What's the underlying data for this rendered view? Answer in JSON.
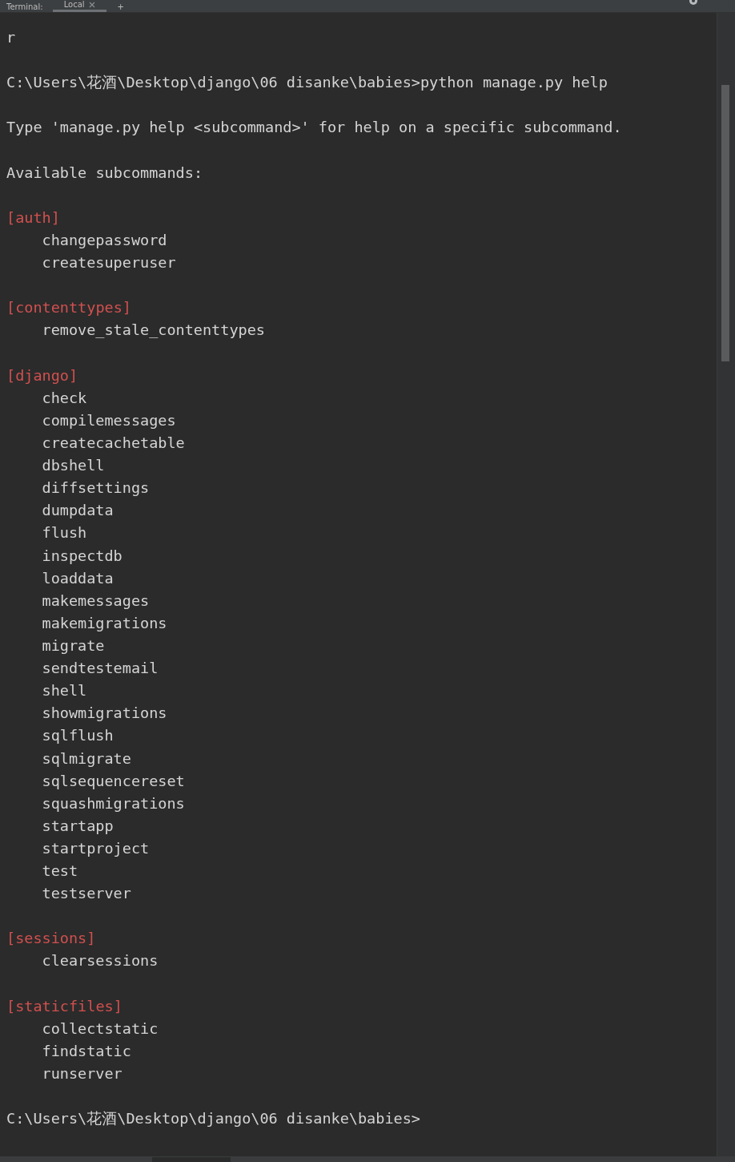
{
  "tabs": [
    {
      "label": "Terminal:",
      "kind": "title"
    },
    {
      "label": "Local",
      "kind": "tab",
      "selected": true,
      "closable": true
    },
    {
      "label": "+",
      "kind": "add"
    }
  ],
  "lines": [
    {
      "kind": "output",
      "text": "r"
    },
    {
      "kind": "blank"
    },
    {
      "kind": "prompt",
      "text": "C:\\Users\\花酒\\Desktop\\django\\06 disanke\\babies>python manage.py help"
    },
    {
      "kind": "blank"
    },
    {
      "kind": "output",
      "text": "Type 'manage.py help <subcommand>' for help on a specific subcommand."
    },
    {
      "kind": "blank"
    },
    {
      "kind": "output",
      "text": "Available subcommands:"
    },
    {
      "kind": "blank"
    },
    {
      "kind": "section",
      "text": "[auth]"
    },
    {
      "kind": "command",
      "text": "changepassword"
    },
    {
      "kind": "command",
      "text": "createsuperuser"
    },
    {
      "kind": "blank"
    },
    {
      "kind": "section",
      "text": "[contenttypes]"
    },
    {
      "kind": "command",
      "text": "remove_stale_contenttypes"
    },
    {
      "kind": "blank"
    },
    {
      "kind": "section",
      "text": "[django]"
    },
    {
      "kind": "command",
      "text": "check"
    },
    {
      "kind": "command",
      "text": "compilemessages"
    },
    {
      "kind": "command",
      "text": "createcachetable"
    },
    {
      "kind": "command",
      "text": "dbshell"
    },
    {
      "kind": "command",
      "text": "diffsettings"
    },
    {
      "kind": "command",
      "text": "dumpdata"
    },
    {
      "kind": "command",
      "text": "flush"
    },
    {
      "kind": "command",
      "text": "inspectdb"
    },
    {
      "kind": "command",
      "text": "loaddata"
    },
    {
      "kind": "command",
      "text": "makemessages"
    },
    {
      "kind": "command",
      "text": "makemigrations"
    },
    {
      "kind": "command",
      "text": "migrate"
    },
    {
      "kind": "command",
      "text": "sendtestemail"
    },
    {
      "kind": "command",
      "text": "shell"
    },
    {
      "kind": "command",
      "text": "showmigrations"
    },
    {
      "kind": "command",
      "text": "sqlflush"
    },
    {
      "kind": "command",
      "text": "sqlmigrate"
    },
    {
      "kind": "command",
      "text": "sqlsequencereset"
    },
    {
      "kind": "command",
      "text": "squashmigrations"
    },
    {
      "kind": "command",
      "text": "startapp"
    },
    {
      "kind": "command",
      "text": "startproject"
    },
    {
      "kind": "command",
      "text": "test"
    },
    {
      "kind": "command",
      "text": "testserver"
    },
    {
      "kind": "blank"
    },
    {
      "kind": "section",
      "text": "[sessions]"
    },
    {
      "kind": "command",
      "text": "clearsessions"
    },
    {
      "kind": "blank"
    },
    {
      "kind": "section",
      "text": "[staticfiles]"
    },
    {
      "kind": "command",
      "text": "collectstatic"
    },
    {
      "kind": "command",
      "text": "findstatic"
    },
    {
      "kind": "command",
      "text": "runserver"
    },
    {
      "kind": "blank"
    },
    {
      "kind": "prompt",
      "text": "C:\\Users\\花酒\\Desktop\\django\\06 disanke\\babies>"
    }
  ]
}
